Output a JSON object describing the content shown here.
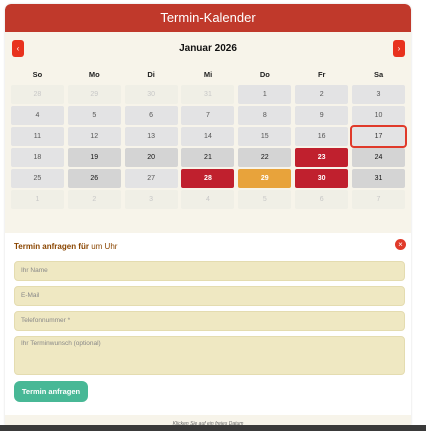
{
  "calendar": {
    "title": "Termin-Kalender",
    "prev_label": "‹",
    "next_label": "›",
    "month": "Januar 2026",
    "weekdays": [
      "So",
      "Mo",
      "Di",
      "Mi",
      "Do",
      "Fr",
      "Sa"
    ],
    "weeks": [
      [
        {
          "label": "28",
          "state": "other"
        },
        {
          "label": "29",
          "state": "other"
        },
        {
          "label": "30",
          "state": "other"
        },
        {
          "label": "31",
          "state": "other"
        },
        {
          "label": "1",
          "state": "normal"
        },
        {
          "label": "2",
          "state": "normal"
        },
        {
          "label": "3",
          "state": "normal"
        }
      ],
      [
        {
          "label": "4",
          "state": "normal"
        },
        {
          "label": "5",
          "state": "normal"
        },
        {
          "label": "6",
          "state": "normal"
        },
        {
          "label": "7",
          "state": "normal"
        },
        {
          "label": "8",
          "state": "normal"
        },
        {
          "label": "9",
          "state": "normal"
        },
        {
          "label": "10",
          "state": "normal"
        }
      ],
      [
        {
          "label": "11",
          "state": "normal"
        },
        {
          "label": "12",
          "state": "normal"
        },
        {
          "label": "13",
          "state": "normal"
        },
        {
          "label": "14",
          "state": "normal"
        },
        {
          "label": "15",
          "state": "normal"
        },
        {
          "label": "16",
          "state": "normal"
        },
        {
          "label": "17",
          "state": "today"
        }
      ],
      [
        {
          "label": "18",
          "state": "normal"
        },
        {
          "label": "19",
          "state": "sel"
        },
        {
          "label": "20",
          "state": "sel"
        },
        {
          "label": "21",
          "state": "sel"
        },
        {
          "label": "22",
          "state": "sel"
        },
        {
          "label": "23",
          "state": "booked"
        },
        {
          "label": "24",
          "state": "sel"
        }
      ],
      [
        {
          "label": "25",
          "state": "normal"
        },
        {
          "label": "26",
          "state": "sel"
        },
        {
          "label": "27",
          "state": "normal"
        },
        {
          "label": "28",
          "state": "booked"
        },
        {
          "label": "29",
          "state": "partial"
        },
        {
          "label": "30",
          "state": "booked"
        },
        {
          "label": "31",
          "state": "sel"
        }
      ],
      [
        {
          "label": "1",
          "state": "other"
        },
        {
          "label": "2",
          "state": "other"
        },
        {
          "label": "3",
          "state": "other"
        },
        {
          "label": "4",
          "state": "other"
        },
        {
          "label": "5",
          "state": "other"
        },
        {
          "label": "6",
          "state": "other"
        },
        {
          "label": "7",
          "state": "other"
        }
      ]
    ]
  },
  "form": {
    "title_bold": "Termin anfragen für",
    "title_rest": " um Uhr",
    "close_label": "×",
    "name_placeholder": "Ihr Name",
    "email_placeholder": "E-Mail",
    "phone_placeholder": "Telefonnummer *",
    "wish_placeholder": "Ihr Terminwunsch (optional)",
    "submit_label": "Termin anfragen"
  },
  "footer": {
    "hint": "Klicken Sie auf ein freies Datum"
  },
  "colors": {
    "header": "#c0392b",
    "booked": "#c0202e",
    "partial": "#e8a33b",
    "submit": "#48b896",
    "field": "#efe8c2"
  }
}
